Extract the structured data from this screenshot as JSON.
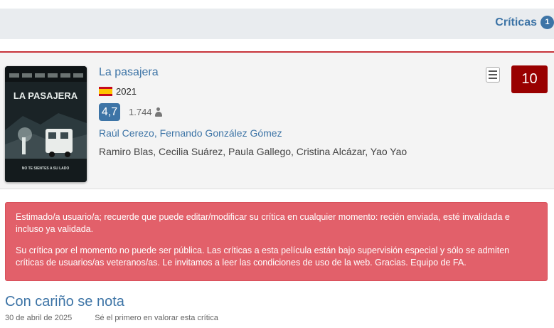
{
  "header": {
    "tab_label": "Críticas",
    "tab_count": "1"
  },
  "movie": {
    "title": "La pasajera",
    "country_flag": "spain-flag",
    "year": "2021",
    "rating": "4,7",
    "votes": "1.744",
    "directors": [
      "Raúl Cerezo",
      "Fernando González Gómez"
    ],
    "cast": "Ramiro Blas, Cecilia Suárez, Paula Gallego, Cristina Alcázar, Yao Yao",
    "user_score": "10",
    "poster": {
      "title_text": "LA PASAJERA",
      "tagline": "NO TE SIENTES A SU LADO"
    }
  },
  "alert": {
    "line1": "Estimado/a usuario/a; recuerde que puede editar/modificar su crítica en cualquier momento: recién enviada, esté invalidada e incluso ya validada.",
    "line2": "Su crítica por el momento no puede ser pública. Las críticas a esta película están bajo supervisión especial y sólo se admiten críticas de usuarios/as veteranos/as. Le invitamos a leer las condiciones de uso de la web. Gracias. Equipo de FA."
  },
  "review": {
    "title": "Con cariño se nota",
    "date": "30 de abril de 2025",
    "first_rate": "Sé el primero en valorar esta crítica"
  },
  "colors": {
    "accent": "#3d74a6",
    "score": "#990000",
    "alert": "#e2606a",
    "divider": "#c7343a"
  }
}
